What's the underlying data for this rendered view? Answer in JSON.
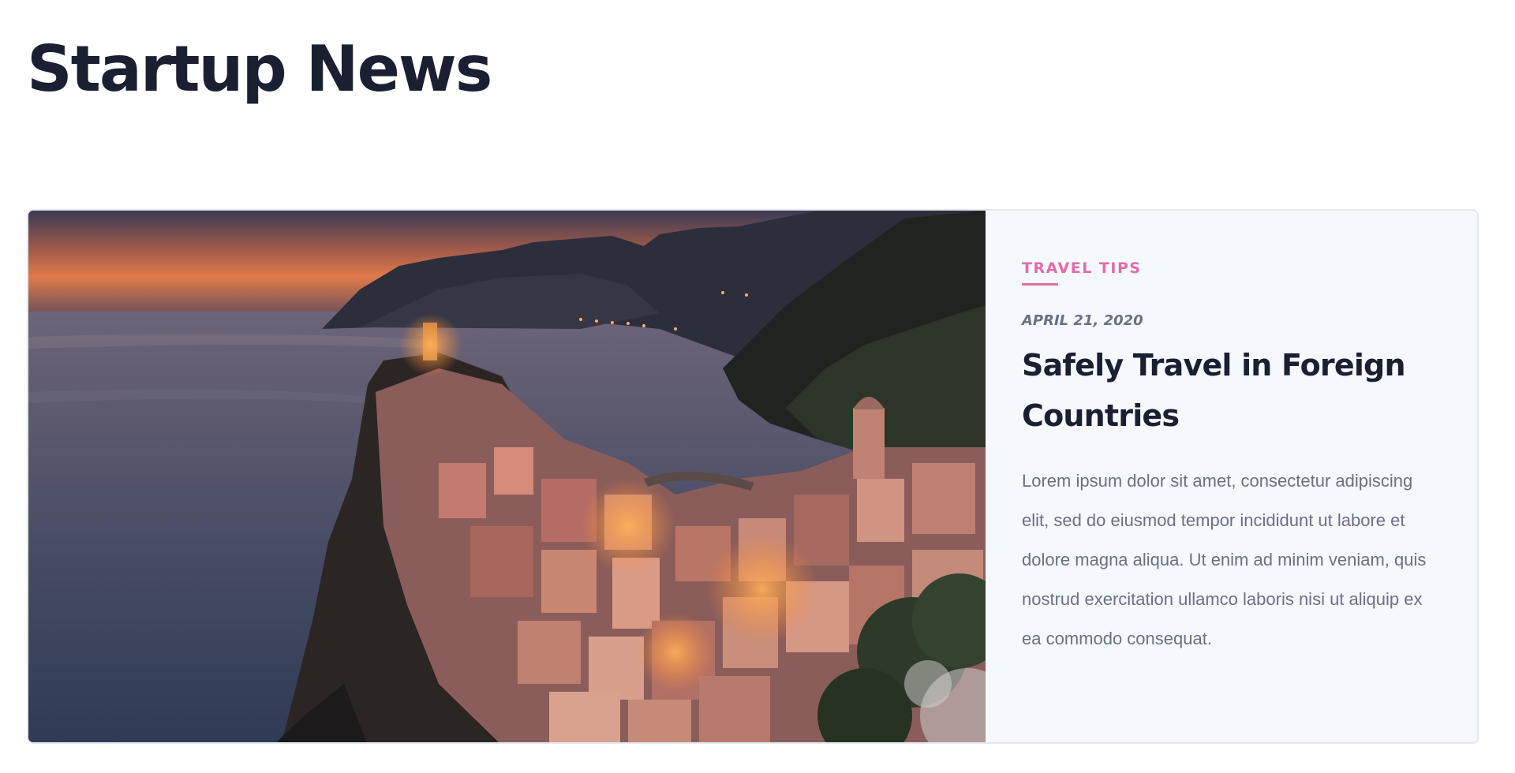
{
  "page": {
    "title": "Startup News"
  },
  "article": {
    "category": "TRAVEL TIPS",
    "date": "APRIL 21, 2020",
    "headline": "Safely Travel in Foreign Countries",
    "excerpt": "Lorem ipsum dolor sit amet, consectetur adipiscing elit, sed do eiusmod tempor incididunt ut labore et dolore magna aliqua. Ut enim ad minim veniam, quis nostrud exercitation ullamco laboris nisi ut aliquip ex ea commodo consequat."
  },
  "colors": {
    "accent": "#e36ba8",
    "title": "#1a2032",
    "muted": "#6a7184",
    "card_bg": "#f5f8fc"
  }
}
